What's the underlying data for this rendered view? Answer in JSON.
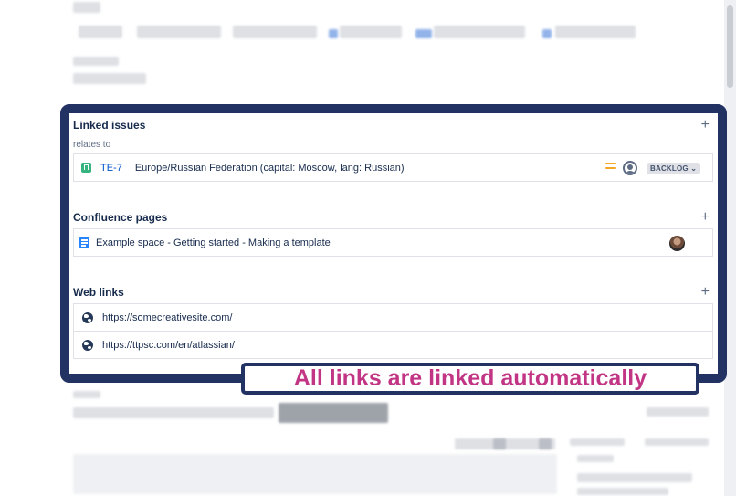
{
  "linked_issues": {
    "title": "Linked issues",
    "relation": "relates to",
    "issue": {
      "key": "TE-7",
      "summary": "Europe/Russian Federation (capital: Moscow, lang: Russian)",
      "status": "BACKLOG",
      "priority": "medium"
    }
  },
  "confluence": {
    "title": "Confluence pages",
    "page": "Example space - Getting started - Making a template"
  },
  "web_links": {
    "title": "Web links",
    "links": [
      "https://somecreativesite.com/",
      "https://ttpsc.com/en/atlassian/"
    ]
  },
  "callout": {
    "text": "All links are linked automatically",
    "color": "#c13584",
    "frame_color": "#223262"
  },
  "icons": {
    "add": "plus-icon",
    "story": "story-icon",
    "priority": "priority-medium-icon",
    "assignee": "user-avatar-icon",
    "status_dropdown": "chevron-down-icon",
    "doc": "confluence-page-icon",
    "web": "globe-icon"
  },
  "glyphs": {
    "plus": "+",
    "chevron": "⌄"
  }
}
